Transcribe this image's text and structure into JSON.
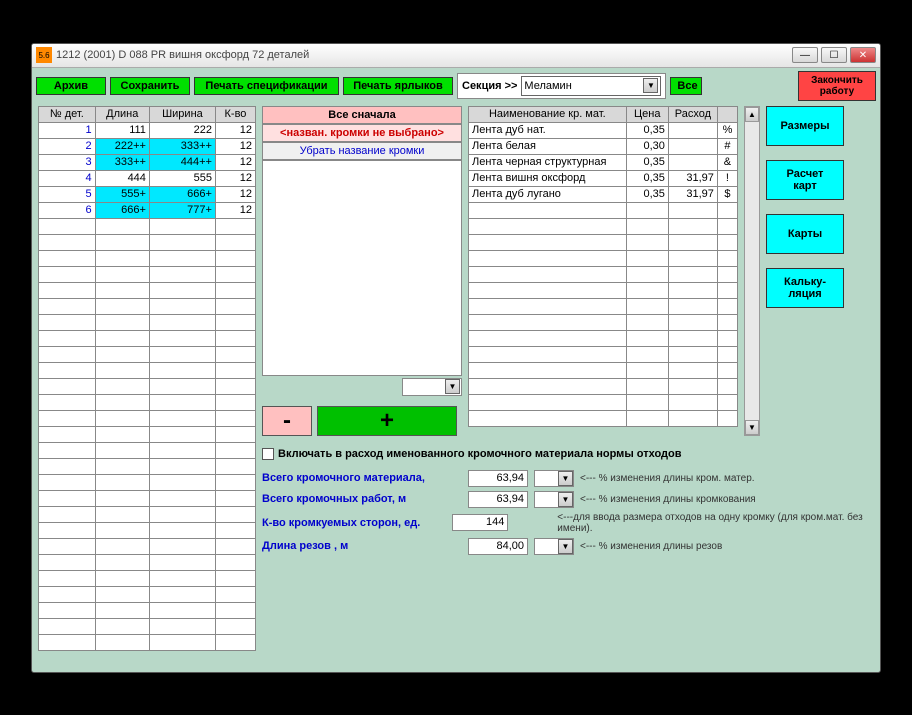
{
  "window": {
    "title": "1212   (2001)  D 088 PR вишня оксфорд  72 деталей"
  },
  "toolbar": {
    "archive": "Архив",
    "save": "Сохранить",
    "print_spec": "Печать спецификации",
    "print_labels": "Печать ярлыков",
    "section_label": "Секция >>",
    "section_value": "Меламин",
    "all": "Все"
  },
  "side": {
    "finish": "Закончить\nработу",
    "sizes": "Размеры",
    "calc_maps": "Расчет\nкарт",
    "maps": "Карты",
    "calculation": "Кальку-\nляция"
  },
  "left_headers": [
    "№ дет.",
    "Длина",
    "Ширина",
    "К-во"
  ],
  "left_rows": [
    {
      "n": "1",
      "len": "111",
      "w": "222",
      "q": "12",
      "hl": [
        false,
        false
      ]
    },
    {
      "n": "2",
      "len": "222++",
      "w": "333++",
      "q": "12",
      "hl": [
        true,
        true
      ]
    },
    {
      "n": "3",
      "len": "333++",
      "w": "444++",
      "q": "12",
      "hl": [
        true,
        true
      ]
    },
    {
      "n": "4",
      "len": "444",
      "w": "555",
      "q": "12",
      "hl": [
        false,
        false
      ]
    },
    {
      "n": "5",
      "len": "555+",
      "w": "666+",
      "q": "12",
      "hl": [
        true,
        true
      ]
    },
    {
      "n": "6",
      "len": "666+",
      "w": "777+",
      "q": "12",
      "hl": [
        true,
        true
      ]
    }
  ],
  "mid": {
    "restart": "Все сначала",
    "not_selected": "<назван. кромки не выбрано>",
    "remove": "Убрать название кромки"
  },
  "right_headers": [
    "Наименование кр. мат.",
    "Цена",
    "Расход",
    ""
  ],
  "right_rows": [
    {
      "name": "Лента дуб нат.",
      "price": "0,35",
      "cons": "",
      "sym": "%"
    },
    {
      "name": "Лента белая",
      "price": "0,30",
      "cons": "",
      "sym": "#"
    },
    {
      "name": "Лента черная структурная",
      "price": "0,35",
      "cons": "",
      "sym": "&"
    },
    {
      "name": "Лента вишня оксфорд",
      "price": "0,35",
      "cons": "31,97",
      "sym": "!"
    },
    {
      "name": "Лента дуб лугано",
      "price": "0,35",
      "cons": "31,97",
      "sym": "$"
    }
  ],
  "checkbox_label": "Включать в расход именованного кромочного материала нормы отходов",
  "summary": [
    {
      "label": "Всего кромочного материала,",
      "val": "63,94",
      "sel": true,
      "hint": "<---  % изменения длины кром. матер."
    },
    {
      "label": "Всего кромочных работ, м",
      "val": "63,94",
      "sel": true,
      "hint": "<--- % изменения длины кромкования"
    },
    {
      "label": "К-во кромкуемых сторон,  ед.",
      "val": "144",
      "sel": false,
      "hint": "<---для ввода размера отходов на одну кромку (для кром.мат. без имени)."
    },
    {
      "label": "Длина резов ,  м",
      "val": "84,00",
      "sel": true,
      "hint": "<--- % изменения длины  резов"
    }
  ]
}
